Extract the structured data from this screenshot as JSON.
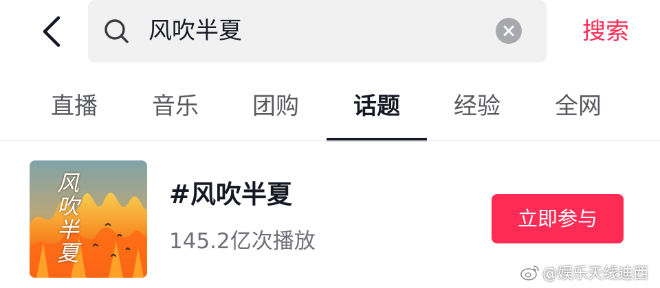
{
  "header": {
    "back_icon": "chevron-left-icon",
    "search": {
      "icon": "search-icon",
      "value": "风吹半夏",
      "clear_icon": "clear-circle-icon"
    },
    "search_button_label": "搜索"
  },
  "tabs": [
    {
      "label": "直播",
      "active": false
    },
    {
      "label": "音乐",
      "active": false
    },
    {
      "label": "团购",
      "active": false
    },
    {
      "label": "话题",
      "active": true
    },
    {
      "label": "经验",
      "active": false
    },
    {
      "label": "全网",
      "active": false
    }
  ],
  "topic": {
    "title": "#风吹半夏",
    "plays": "145.2亿次播放",
    "join_button_label": "立即参与",
    "cover_text": "风吹半夏"
  },
  "watermark": {
    "icon": "weibo-icon",
    "text": "@娱乐天线迪西"
  },
  "colors": {
    "accent": "#fe2c55",
    "text_primary": "#161823",
    "text_secondary": "#6f7077",
    "search_bg": "#f1f1f2"
  }
}
